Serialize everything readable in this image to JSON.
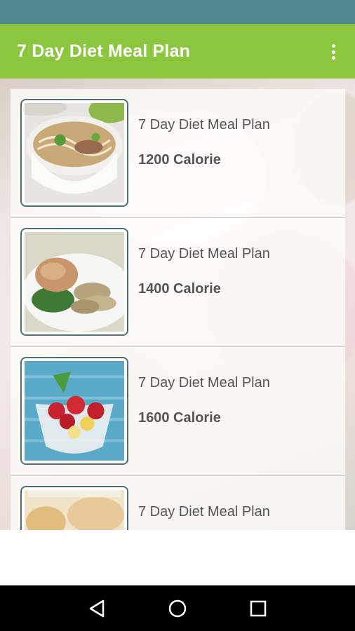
{
  "app": {
    "title": "7 Day Diet Meal Plan"
  },
  "colors": {
    "status_bar": "#4f8a93",
    "app_bar": "#8cc63f",
    "nav_bar": "#000000",
    "thumb_border": "#4d7076"
  },
  "plans": [
    {
      "title": "7 Day Diet Meal Plan",
      "calorie": "1200 Calorie",
      "image": "noodle-soup-bowl"
    },
    {
      "title": "7 Day Diet Meal Plan",
      "calorie": "1400 Calorie",
      "image": "chicken-plate"
    },
    {
      "title": "7 Day Diet Meal Plan",
      "calorie": "1600 Calorie",
      "image": "fruit-parfait"
    },
    {
      "title": "7 Day Diet Meal Plan",
      "calorie": "",
      "image": "bread-loaves"
    }
  ],
  "icons": {
    "overflow": "more-vert-icon",
    "back": "back-triangle-icon",
    "home": "home-circle-icon",
    "recents": "recents-square-icon"
  }
}
